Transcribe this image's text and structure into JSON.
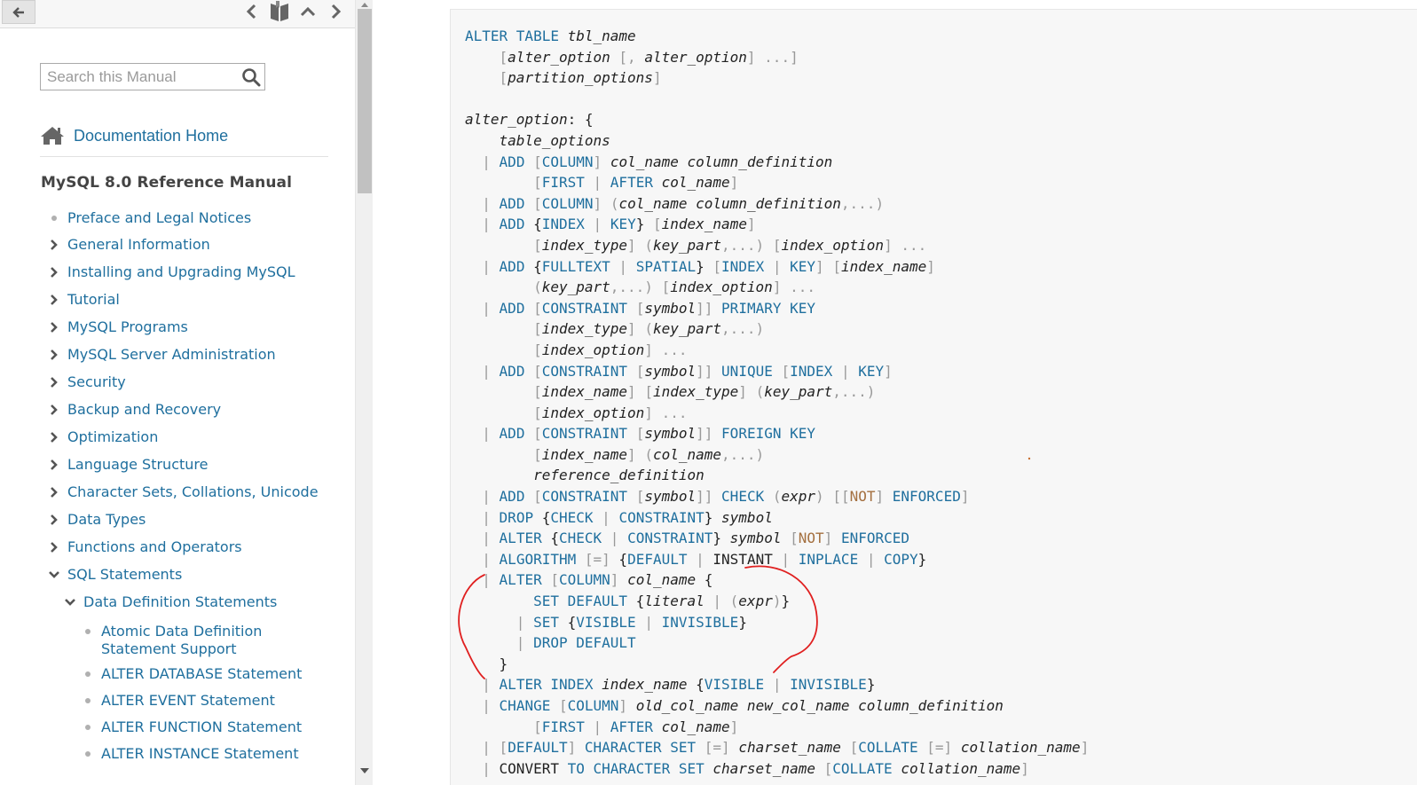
{
  "sidebar": {
    "search_placeholder": "Search this Manual",
    "doc_home": "Documentation Home",
    "manual_title": "MySQL 8.0 Reference Manual",
    "toc": [
      {
        "label": "Preface and Legal Notices",
        "type": "bullet"
      },
      {
        "label": "General Information",
        "type": "collapsed"
      },
      {
        "label": "Installing and Upgrading MySQL",
        "type": "collapsed"
      },
      {
        "label": "Tutorial",
        "type": "collapsed"
      },
      {
        "label": "MySQL Programs",
        "type": "collapsed"
      },
      {
        "label": "MySQL Server Administration",
        "type": "collapsed"
      },
      {
        "label": "Security",
        "type": "collapsed"
      },
      {
        "label": "Backup and Recovery",
        "type": "collapsed"
      },
      {
        "label": "Optimization",
        "type": "collapsed"
      },
      {
        "label": "Language Structure",
        "type": "collapsed"
      },
      {
        "label": "Character Sets, Collations, Unicode",
        "type": "collapsed"
      },
      {
        "label": "Data Types",
        "type": "collapsed"
      },
      {
        "label": "Functions and Operators",
        "type": "collapsed"
      },
      {
        "label": "SQL Statements",
        "type": "expanded"
      },
      {
        "label": "Data Definition Statements",
        "type": "expanded"
      },
      {
        "label": "Atomic Data Definition Statement Support",
        "type": "bullet"
      },
      {
        "label": "ALTER DATABASE Statement",
        "type": "bullet"
      },
      {
        "label": "ALTER EVENT Statement",
        "type": "bullet"
      },
      {
        "label": "ALTER FUNCTION Statement",
        "type": "bullet"
      },
      {
        "label": "ALTER INSTANCE Statement",
        "type": "bullet"
      }
    ]
  },
  "code_lines": [
    [
      [
        "kw",
        "ALTER TABLE "
      ],
      [
        "it",
        "tbl_name"
      ]
    ],
    [
      [
        "tx",
        "    "
      ],
      [
        "pu",
        "["
      ],
      [
        "it",
        "alter_option"
      ],
      [
        "tx",
        " "
      ],
      [
        "pu",
        "[,"
      ],
      [
        "tx",
        " "
      ],
      [
        "it",
        "alter_option"
      ],
      [
        "pu",
        "] ...]"
      ]
    ],
    [
      [
        "tx",
        "    "
      ],
      [
        "pu",
        "["
      ],
      [
        "it",
        "partition_options"
      ],
      [
        "pu",
        "]"
      ]
    ],
    [
      [
        "tx",
        ""
      ]
    ],
    [
      [
        "it",
        "alter_option"
      ],
      [
        "tx",
        ": {"
      ]
    ],
    [
      [
        "tx",
        "    "
      ],
      [
        "it",
        "table_options"
      ]
    ],
    [
      [
        "tx",
        "  "
      ],
      [
        "pu",
        "|"
      ],
      [
        "tx",
        " "
      ],
      [
        "kw",
        "ADD"
      ],
      [
        "tx",
        " "
      ],
      [
        "pu",
        "["
      ],
      [
        "kw",
        "COLUMN"
      ],
      [
        "pu",
        "]"
      ],
      [
        "tx",
        " "
      ],
      [
        "it",
        "col_name column_definition"
      ]
    ],
    [
      [
        "tx",
        "        "
      ],
      [
        "pu",
        "["
      ],
      [
        "kw",
        "FIRST"
      ],
      [
        "tx",
        " "
      ],
      [
        "pu",
        "|"
      ],
      [
        "tx",
        " "
      ],
      [
        "kw",
        "AFTER"
      ],
      [
        "tx",
        " "
      ],
      [
        "it",
        "col_name"
      ],
      [
        "pu",
        "]"
      ]
    ],
    [
      [
        "tx",
        "  "
      ],
      [
        "pu",
        "|"
      ],
      [
        "tx",
        " "
      ],
      [
        "kw",
        "ADD"
      ],
      [
        "tx",
        " "
      ],
      [
        "pu",
        "["
      ],
      [
        "kw",
        "COLUMN"
      ],
      [
        "pu",
        "]"
      ],
      [
        "tx",
        " "
      ],
      [
        "pu",
        "("
      ],
      [
        "it",
        "col_name column_definition"
      ],
      [
        "pu",
        ",...)"
      ]
    ],
    [
      [
        "tx",
        "  "
      ],
      [
        "pu",
        "|"
      ],
      [
        "tx",
        " "
      ],
      [
        "kw",
        "ADD"
      ],
      [
        "tx",
        " {"
      ],
      [
        "kw",
        "INDEX"
      ],
      [
        "tx",
        " "
      ],
      [
        "pu",
        "|"
      ],
      [
        "tx",
        " "
      ],
      [
        "kw",
        "KEY"
      ],
      [
        "tx",
        "} "
      ],
      [
        "pu",
        "["
      ],
      [
        "it",
        "index_name"
      ],
      [
        "pu",
        "]"
      ]
    ],
    [
      [
        "tx",
        "        "
      ],
      [
        "pu",
        "["
      ],
      [
        "it",
        "index_type"
      ],
      [
        "pu",
        "]"
      ],
      [
        "tx",
        " "
      ],
      [
        "pu",
        "("
      ],
      [
        "it",
        "key_part"
      ],
      [
        "pu",
        ",...)"
      ],
      [
        "tx",
        " "
      ],
      [
        "pu",
        "["
      ],
      [
        "it",
        "index_option"
      ],
      [
        "pu",
        "] ..."
      ]
    ],
    [
      [
        "tx",
        "  "
      ],
      [
        "pu",
        "|"
      ],
      [
        "tx",
        " "
      ],
      [
        "kw",
        "ADD"
      ],
      [
        "tx",
        " {"
      ],
      [
        "kw",
        "FULLTEXT"
      ],
      [
        "tx",
        " "
      ],
      [
        "pu",
        "|"
      ],
      [
        "tx",
        " "
      ],
      [
        "kw",
        "SPATIAL"
      ],
      [
        "tx",
        "} "
      ],
      [
        "pu",
        "["
      ],
      [
        "kw",
        "INDEX"
      ],
      [
        "tx",
        " "
      ],
      [
        "pu",
        "|"
      ],
      [
        "tx",
        " "
      ],
      [
        "kw",
        "KEY"
      ],
      [
        "pu",
        "]"
      ],
      [
        "tx",
        " "
      ],
      [
        "pu",
        "["
      ],
      [
        "it",
        "index_name"
      ],
      [
        "pu",
        "]"
      ]
    ],
    [
      [
        "tx",
        "        "
      ],
      [
        "pu",
        "("
      ],
      [
        "it",
        "key_part"
      ],
      [
        "pu",
        ",...)"
      ],
      [
        "tx",
        " "
      ],
      [
        "pu",
        "["
      ],
      [
        "it",
        "index_option"
      ],
      [
        "pu",
        "] ..."
      ]
    ],
    [
      [
        "tx",
        "  "
      ],
      [
        "pu",
        "|"
      ],
      [
        "tx",
        " "
      ],
      [
        "kw",
        "ADD"
      ],
      [
        "tx",
        " "
      ],
      [
        "pu",
        "["
      ],
      [
        "kw",
        "CONSTRAINT"
      ],
      [
        "tx",
        " "
      ],
      [
        "pu",
        "["
      ],
      [
        "it",
        "symbol"
      ],
      [
        "pu",
        "]]"
      ],
      [
        "tx",
        " "
      ],
      [
        "kw",
        "PRIMARY KEY"
      ]
    ],
    [
      [
        "tx",
        "        "
      ],
      [
        "pu",
        "["
      ],
      [
        "it",
        "index_type"
      ],
      [
        "pu",
        "]"
      ],
      [
        "tx",
        " "
      ],
      [
        "pu",
        "("
      ],
      [
        "it",
        "key_part"
      ],
      [
        "pu",
        ",...)"
      ]
    ],
    [
      [
        "tx",
        "        "
      ],
      [
        "pu",
        "["
      ],
      [
        "it",
        "index_option"
      ],
      [
        "pu",
        "] ..."
      ]
    ],
    [
      [
        "tx",
        "  "
      ],
      [
        "pu",
        "|"
      ],
      [
        "tx",
        " "
      ],
      [
        "kw",
        "ADD"
      ],
      [
        "tx",
        " "
      ],
      [
        "pu",
        "["
      ],
      [
        "kw",
        "CONSTRAINT"
      ],
      [
        "tx",
        " "
      ],
      [
        "pu",
        "["
      ],
      [
        "it",
        "symbol"
      ],
      [
        "pu",
        "]]"
      ],
      [
        "tx",
        " "
      ],
      [
        "kw",
        "UNIQUE"
      ],
      [
        "tx",
        " "
      ],
      [
        "pu",
        "["
      ],
      [
        "kw",
        "INDEX"
      ],
      [
        "tx",
        " "
      ],
      [
        "pu",
        "|"
      ],
      [
        "tx",
        " "
      ],
      [
        "kw",
        "KEY"
      ],
      [
        "pu",
        "]"
      ]
    ],
    [
      [
        "tx",
        "        "
      ],
      [
        "pu",
        "["
      ],
      [
        "it",
        "index_name"
      ],
      [
        "pu",
        "]"
      ],
      [
        "tx",
        " "
      ],
      [
        "pu",
        "["
      ],
      [
        "it",
        "index_type"
      ],
      [
        "pu",
        "]"
      ],
      [
        "tx",
        " "
      ],
      [
        "pu",
        "("
      ],
      [
        "it",
        "key_part"
      ],
      [
        "pu",
        ",...)"
      ]
    ],
    [
      [
        "tx",
        "        "
      ],
      [
        "pu",
        "["
      ],
      [
        "it",
        "index_option"
      ],
      [
        "pu",
        "] ..."
      ]
    ],
    [
      [
        "tx",
        "  "
      ],
      [
        "pu",
        "|"
      ],
      [
        "tx",
        " "
      ],
      [
        "kw",
        "ADD"
      ],
      [
        "tx",
        " "
      ],
      [
        "pu",
        "["
      ],
      [
        "kw",
        "CONSTRAINT"
      ],
      [
        "tx",
        " "
      ],
      [
        "pu",
        "["
      ],
      [
        "it",
        "symbol"
      ],
      [
        "pu",
        "]]"
      ],
      [
        "tx",
        " "
      ],
      [
        "kw",
        "FOREIGN KEY"
      ]
    ],
    [
      [
        "tx",
        "        "
      ],
      [
        "pu",
        "["
      ],
      [
        "it",
        "index_name"
      ],
      [
        "pu",
        "]"
      ],
      [
        "tx",
        " "
      ],
      [
        "pu",
        "("
      ],
      [
        "it",
        "col_name"
      ],
      [
        "pu",
        ",...)"
      ]
    ],
    [
      [
        "tx",
        "        "
      ],
      [
        "it",
        "reference_definition"
      ]
    ],
    [
      [
        "tx",
        "  "
      ],
      [
        "pu",
        "|"
      ],
      [
        "tx",
        " "
      ],
      [
        "kw",
        "ADD"
      ],
      [
        "tx",
        " "
      ],
      [
        "pu",
        "["
      ],
      [
        "kw",
        "CONSTRAINT"
      ],
      [
        "tx",
        " "
      ],
      [
        "pu",
        "["
      ],
      [
        "it",
        "symbol"
      ],
      [
        "pu",
        "]]"
      ],
      [
        "tx",
        " "
      ],
      [
        "kw",
        "CHECK"
      ],
      [
        "tx",
        " "
      ],
      [
        "pu",
        "("
      ],
      [
        "it",
        "expr"
      ],
      [
        "pu",
        ")"
      ],
      [
        "tx",
        " "
      ],
      [
        "pu",
        "[["
      ],
      [
        "op",
        "NOT"
      ],
      [
        "pu",
        "]"
      ],
      [
        "tx",
        " "
      ],
      [
        "kw",
        "ENFORCED"
      ],
      [
        "pu",
        "]"
      ]
    ],
    [
      [
        "tx",
        "  "
      ],
      [
        "pu",
        "|"
      ],
      [
        "tx",
        " "
      ],
      [
        "kw",
        "DROP"
      ],
      [
        "tx",
        " {"
      ],
      [
        "kw",
        "CHECK"
      ],
      [
        "tx",
        " "
      ],
      [
        "pu",
        "|"
      ],
      [
        "tx",
        " "
      ],
      [
        "kw",
        "CONSTRAINT"
      ],
      [
        "tx",
        "} "
      ],
      [
        "it",
        "symbol"
      ]
    ],
    [
      [
        "tx",
        "  "
      ],
      [
        "pu",
        "|"
      ],
      [
        "tx",
        " "
      ],
      [
        "kw",
        "ALTER"
      ],
      [
        "tx",
        " {"
      ],
      [
        "kw",
        "CHECK"
      ],
      [
        "tx",
        " "
      ],
      [
        "pu",
        "|"
      ],
      [
        "tx",
        " "
      ],
      [
        "kw",
        "CONSTRAINT"
      ],
      [
        "tx",
        "} "
      ],
      [
        "it",
        "symbol"
      ],
      [
        "tx",
        " "
      ],
      [
        "pu",
        "["
      ],
      [
        "op",
        "NOT"
      ],
      [
        "pu",
        "]"
      ],
      [
        "tx",
        " "
      ],
      [
        "kw",
        "ENFORCED"
      ]
    ],
    [
      [
        "tx",
        "  "
      ],
      [
        "pu",
        "|"
      ],
      [
        "tx",
        " "
      ],
      [
        "kw",
        "ALGORITHM"
      ],
      [
        "tx",
        " "
      ],
      [
        "pu",
        "[=]"
      ],
      [
        "tx",
        " {"
      ],
      [
        "kw",
        "DEFAULT"
      ],
      [
        "tx",
        " "
      ],
      [
        "pu",
        "|"
      ],
      [
        "tx",
        " INSTANT "
      ],
      [
        "pu",
        "|"
      ],
      [
        "tx",
        " "
      ],
      [
        "kw",
        "INPLACE"
      ],
      [
        "tx",
        " "
      ],
      [
        "pu",
        "|"
      ],
      [
        "tx",
        " "
      ],
      [
        "kw",
        "COPY"
      ],
      [
        "tx",
        "}"
      ]
    ],
    [
      [
        "tx",
        "  "
      ],
      [
        "pu",
        "|"
      ],
      [
        "tx",
        " "
      ],
      [
        "kw",
        "ALTER"
      ],
      [
        "tx",
        " "
      ],
      [
        "pu",
        "["
      ],
      [
        "kw",
        "COLUMN"
      ],
      [
        "pu",
        "]"
      ],
      [
        "tx",
        " "
      ],
      [
        "it",
        "col_name"
      ],
      [
        "tx",
        " {"
      ]
    ],
    [
      [
        "tx",
        "        "
      ],
      [
        "kw",
        "SET DEFAULT"
      ],
      [
        "tx",
        " {"
      ],
      [
        "it",
        "literal"
      ],
      [
        "tx",
        " "
      ],
      [
        "pu",
        "|"
      ],
      [
        "tx",
        " "
      ],
      [
        "pu",
        "("
      ],
      [
        "it",
        "expr"
      ],
      [
        "pu",
        ")"
      ],
      [
        "tx",
        "}"
      ]
    ],
    [
      [
        "tx",
        "      "
      ],
      [
        "pu",
        "|"
      ],
      [
        "tx",
        " "
      ],
      [
        "kw",
        "SET"
      ],
      [
        "tx",
        " {"
      ],
      [
        "kw",
        "VISIBLE"
      ],
      [
        "tx",
        " "
      ],
      [
        "pu",
        "|"
      ],
      [
        "tx",
        " "
      ],
      [
        "kw",
        "INVISIBLE"
      ],
      [
        "tx",
        "}"
      ]
    ],
    [
      [
        "tx",
        "      "
      ],
      [
        "pu",
        "|"
      ],
      [
        "tx",
        " "
      ],
      [
        "kw",
        "DROP DEFAULT"
      ]
    ],
    [
      [
        "tx",
        "    }"
      ]
    ],
    [
      [
        "tx",
        "  "
      ],
      [
        "pu",
        "|"
      ],
      [
        "tx",
        " "
      ],
      [
        "kw",
        "ALTER INDEX"
      ],
      [
        "tx",
        " "
      ],
      [
        "it",
        "index_name"
      ],
      [
        "tx",
        " {"
      ],
      [
        "kw",
        "VISIBLE"
      ],
      [
        "tx",
        " "
      ],
      [
        "pu",
        "|"
      ],
      [
        "tx",
        " "
      ],
      [
        "kw",
        "INVISIBLE"
      ],
      [
        "tx",
        "}"
      ]
    ],
    [
      [
        "tx",
        "  "
      ],
      [
        "pu",
        "|"
      ],
      [
        "tx",
        " "
      ],
      [
        "kw",
        "CHANGE"
      ],
      [
        "tx",
        " "
      ],
      [
        "pu",
        "["
      ],
      [
        "kw",
        "COLUMN"
      ],
      [
        "pu",
        "]"
      ],
      [
        "tx",
        " "
      ],
      [
        "it",
        "old_col_name new_col_name column_definition"
      ]
    ],
    [
      [
        "tx",
        "        "
      ],
      [
        "pu",
        "["
      ],
      [
        "kw",
        "FIRST"
      ],
      [
        "tx",
        " "
      ],
      [
        "pu",
        "|"
      ],
      [
        "tx",
        " "
      ],
      [
        "kw",
        "AFTER"
      ],
      [
        "tx",
        " "
      ],
      [
        "it",
        "col_name"
      ],
      [
        "pu",
        "]"
      ]
    ],
    [
      [
        "tx",
        "  "
      ],
      [
        "pu",
        "|"
      ],
      [
        "tx",
        " "
      ],
      [
        "pu",
        "["
      ],
      [
        "kw",
        "DEFAULT"
      ],
      [
        "pu",
        "]"
      ],
      [
        "tx",
        " "
      ],
      [
        "kw",
        "CHARACTER SET"
      ],
      [
        "tx",
        " "
      ],
      [
        "pu",
        "[=]"
      ],
      [
        "tx",
        " "
      ],
      [
        "it",
        "charset_name"
      ],
      [
        "tx",
        " "
      ],
      [
        "pu",
        "["
      ],
      [
        "kw",
        "COLLATE"
      ],
      [
        "tx",
        " "
      ],
      [
        "pu",
        "[=]"
      ],
      [
        "tx",
        " "
      ],
      [
        "it",
        "collation_name"
      ],
      [
        "pu",
        "]"
      ]
    ],
    [
      [
        "tx",
        "  "
      ],
      [
        "pu",
        "|"
      ],
      [
        "tx",
        " CONVERT "
      ],
      [
        "kw",
        "TO CHARACTER SET"
      ],
      [
        "tx",
        " "
      ],
      [
        "it",
        "charset_name"
      ],
      [
        "tx",
        " "
      ],
      [
        "pu",
        "["
      ],
      [
        "kw",
        "COLLATE"
      ],
      [
        "tx",
        " "
      ],
      [
        "it",
        "collation_name"
      ],
      [
        "pu",
        "]"
      ]
    ]
  ]
}
